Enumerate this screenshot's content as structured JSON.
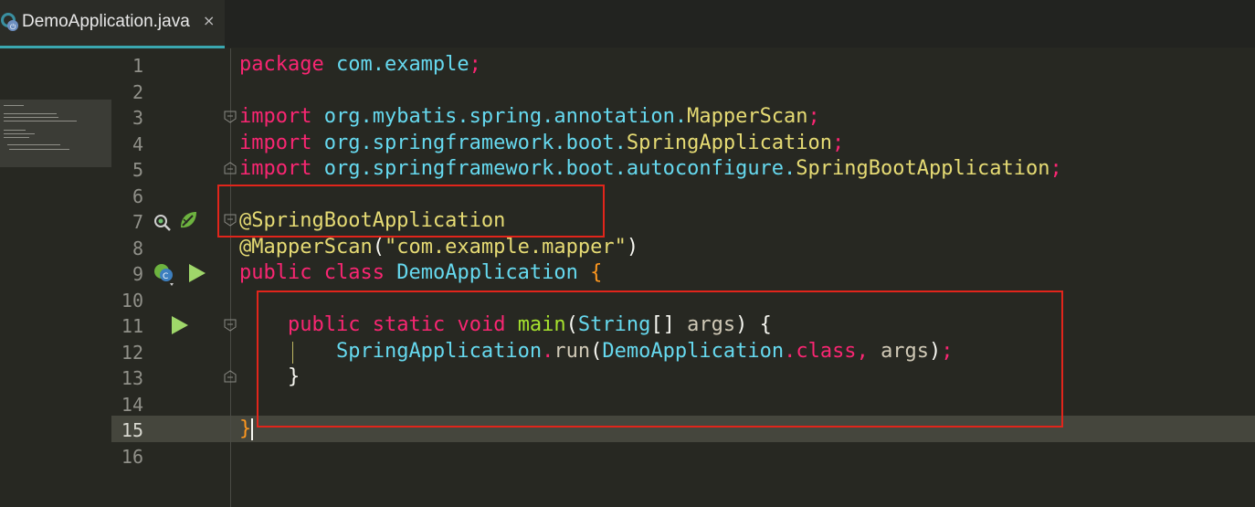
{
  "tab": {
    "title": "DemoApplication.java",
    "close_glyph": "×",
    "icon": "spring-class-icon"
  },
  "gutter": {
    "line_numbers": [
      "1",
      "2",
      "3",
      "4",
      "5",
      "6",
      "7",
      "8",
      "9",
      "10",
      "11",
      "12",
      "13",
      "14",
      "15",
      "16"
    ],
    "icons": [
      "inspect-bean-icon",
      "spring-leaf-icon",
      "spring-class-icon",
      "run-icon"
    ]
  },
  "code": {
    "l1": {
      "kw": "package",
      "rest": "com.example",
      "semi": ";"
    },
    "l3": {
      "kw": "import",
      "pkg": "org.mybatis.spring.annotation.",
      "cls": "MapperScan",
      "semi": ";"
    },
    "l4": {
      "kw": "import",
      "pkg": "org.springframework.boot.",
      "cls": "SpringApplication",
      "semi": ";"
    },
    "l5": {
      "kw": "import",
      "pkg": "org.springframework.boot.autoconfigure.",
      "cls": "SpringBootApplication",
      "semi": ";"
    },
    "l7": {
      "ann": "@SpringBootApplication"
    },
    "l8": {
      "ann": "@MapperScan",
      "open": "(",
      "str": "\"com.example.mapper\"",
      "close": ")"
    },
    "l9": {
      "kw1": "public",
      "kw2": "class",
      "cls": "DemoApplication",
      "brace": "{"
    },
    "l11": {
      "kw1": "public",
      "kw2": "static",
      "kw3": "void",
      "fn": "main",
      "open": "(",
      "type": "String",
      "arr": "[]",
      "arg": "args",
      "close": ")",
      "brace": "{"
    },
    "l12": {
      "type": "SpringApplication",
      "dot": ".",
      "fn": "run",
      "open": "(",
      "cls": "DemoApplication",
      "dot2": ".",
      "kw": "class",
      "comma": ",",
      "arg": "args",
      "close": ")",
      "semi": ";"
    },
    "l13": {
      "brace": "}"
    },
    "l15": {
      "brace": "}"
    }
  },
  "colors": {
    "background": "#272822",
    "keyword": "#f92672",
    "type": "#66d9ef",
    "string": "#e6db74",
    "function": "#a6e22e",
    "highlight_box": "#e1251b",
    "current_line": "#45463d"
  }
}
